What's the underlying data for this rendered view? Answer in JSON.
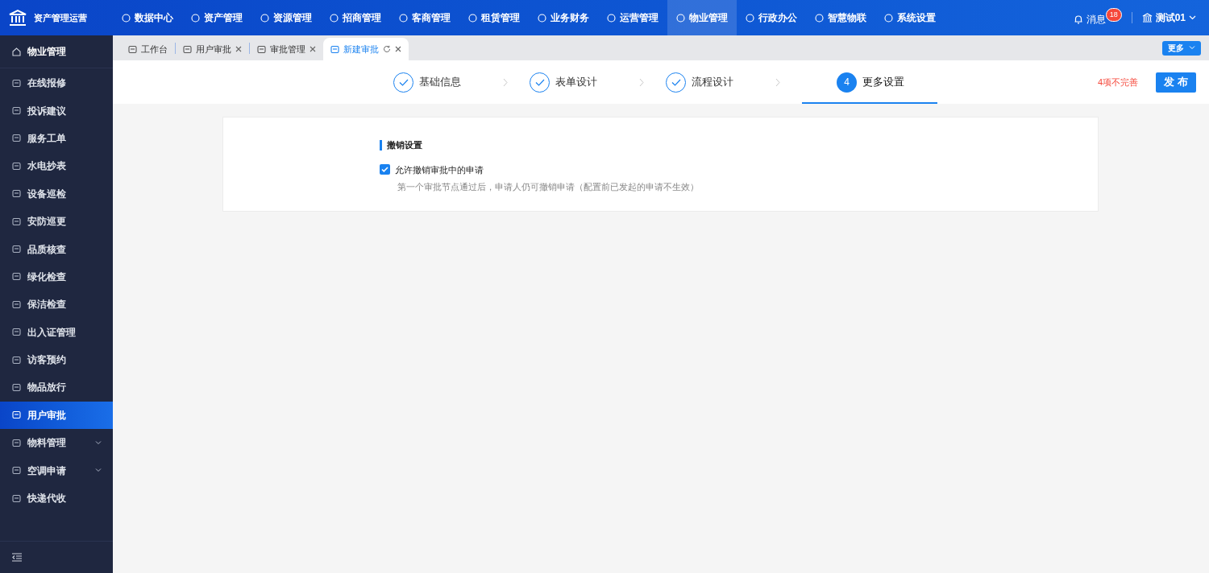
{
  "app": {
    "title": "资产管理运营"
  },
  "top_nav": [
    {
      "label": "数据中心",
      "selected": false
    },
    {
      "label": "资产管理",
      "selected": false
    },
    {
      "label": "资源管理",
      "selected": false
    },
    {
      "label": "招商管理",
      "selected": false
    },
    {
      "label": "客商管理",
      "selected": false
    },
    {
      "label": "租赁管理",
      "selected": false
    },
    {
      "label": "业务财务",
      "selected": false
    },
    {
      "label": "运营管理",
      "selected": false
    },
    {
      "label": "物业管理",
      "selected": true
    },
    {
      "label": "行政办公",
      "selected": false
    },
    {
      "label": "智慧物联",
      "selected": false
    },
    {
      "label": "系统设置",
      "selected": false
    }
  ],
  "messages": {
    "label": "消息",
    "badge": "18"
  },
  "user": {
    "name": "测试01"
  },
  "sidebar": {
    "title": "物业管理",
    "items": [
      {
        "label": "在线报修",
        "selected": false,
        "expandable": false
      },
      {
        "label": "投诉建议",
        "selected": false,
        "expandable": false
      },
      {
        "label": "服务工单",
        "selected": false,
        "expandable": false
      },
      {
        "label": "水电抄表",
        "selected": false,
        "expandable": false
      },
      {
        "label": "设备巡检",
        "selected": false,
        "expandable": false
      },
      {
        "label": "安防巡更",
        "selected": false,
        "expandable": false
      },
      {
        "label": "品质核查",
        "selected": false,
        "expandable": false
      },
      {
        "label": "绿化检查",
        "selected": false,
        "expandable": false
      },
      {
        "label": "保洁检查",
        "selected": false,
        "expandable": false
      },
      {
        "label": "出入证管理",
        "selected": false,
        "expandable": false
      },
      {
        "label": "访客预约",
        "selected": false,
        "expandable": false
      },
      {
        "label": "物品放行",
        "selected": false,
        "expandable": false
      },
      {
        "label": "用户审批",
        "selected": true,
        "expandable": false
      },
      {
        "label": "物料管理",
        "selected": false,
        "expandable": true
      },
      {
        "label": "空调申请",
        "selected": false,
        "expandable": true
      },
      {
        "label": "快递代收",
        "selected": false,
        "expandable": false
      }
    ]
  },
  "tabs": [
    {
      "label": "工作台",
      "selected": false,
      "closable": false
    },
    {
      "label": "用户审批",
      "selected": false,
      "closable": true
    },
    {
      "label": "审批管理",
      "selected": false,
      "closable": true
    },
    {
      "label": "新建审批",
      "selected": true,
      "closable": true
    }
  ],
  "more_button": "更多",
  "steps": [
    {
      "label": "基础信息",
      "completed": true,
      "selected": false
    },
    {
      "label": "表单设计",
      "completed": true,
      "selected": false
    },
    {
      "label": "流程设计",
      "completed": true,
      "selected": false
    },
    {
      "number": "4",
      "label": "更多设置",
      "completed": false,
      "selected": true
    }
  ],
  "incomplete_notice": "4项不完善",
  "publish_button": "发 布",
  "section": {
    "title": "撤销设置",
    "option": {
      "label": "允许撤销审批中的申请",
      "checked": true,
      "hint": "第一个审批节点通过后，申请人仍可撤销申请（配置前已发起的申请不生效）"
    }
  }
}
